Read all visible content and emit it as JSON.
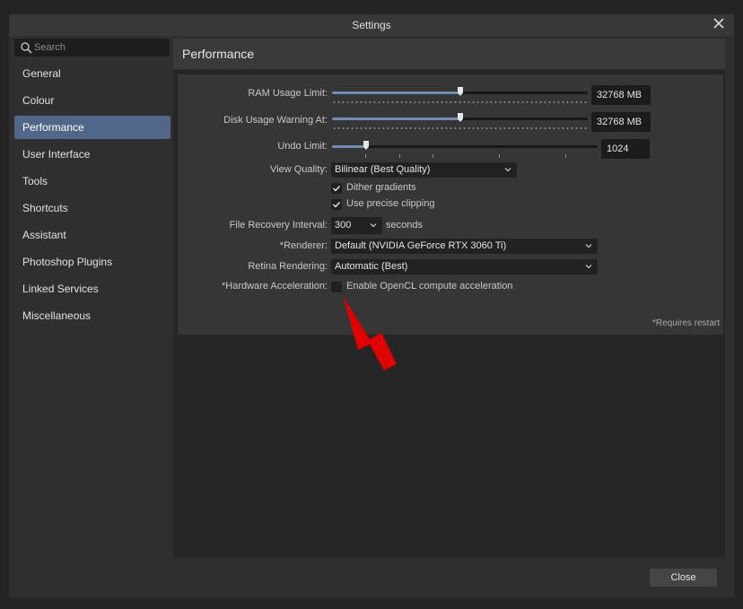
{
  "window": {
    "title": "Settings"
  },
  "search": {
    "placeholder": "Search"
  },
  "sidebar": {
    "items": [
      {
        "label": "General"
      },
      {
        "label": "Colour"
      },
      {
        "label": "Performance"
      },
      {
        "label": "User Interface"
      },
      {
        "label": "Tools"
      },
      {
        "label": "Shortcuts"
      },
      {
        "label": "Assistant"
      },
      {
        "label": "Photoshop Plugins"
      },
      {
        "label": "Linked Services"
      },
      {
        "label": "Miscellaneous"
      }
    ],
    "selected": "Performance"
  },
  "page": {
    "title": "Performance"
  },
  "settings": {
    "ram": {
      "label": "RAM Usage Limit:",
      "value": "32768 MB",
      "fraction": 0.5
    },
    "disk": {
      "label": "Disk Usage Warning At:",
      "value": "32768 MB",
      "fraction": 0.5
    },
    "undo": {
      "label": "Undo Limit:",
      "value": "1024",
      "fraction": 0.13
    },
    "view_quality": {
      "label": "View Quality:",
      "value": "Bilinear (Best Quality)"
    },
    "dither": {
      "label": "Dither gradients",
      "checked": true
    },
    "clipping": {
      "label": "Use precise clipping",
      "checked": true
    },
    "recovery": {
      "label": "File Recovery Interval:",
      "value": "300",
      "unit": "seconds"
    },
    "renderer": {
      "label": "*Renderer:",
      "value": "Default (NVIDIA GeForce RTX 3060 Ti)"
    },
    "retina": {
      "label": "Retina Rendering:",
      "value": "Automatic (Best)"
    },
    "hw_accel": {
      "label": "*Hardware Acceleration:",
      "option": "Enable OpenCL compute acceleration",
      "checked": false
    },
    "restart_note": "*Requires restart"
  },
  "footer": {
    "close_label": "Close"
  },
  "colors": {
    "accent": "#50678a",
    "slider_fill": "#6e8cb5",
    "annotation_arrow": "#e00000"
  }
}
